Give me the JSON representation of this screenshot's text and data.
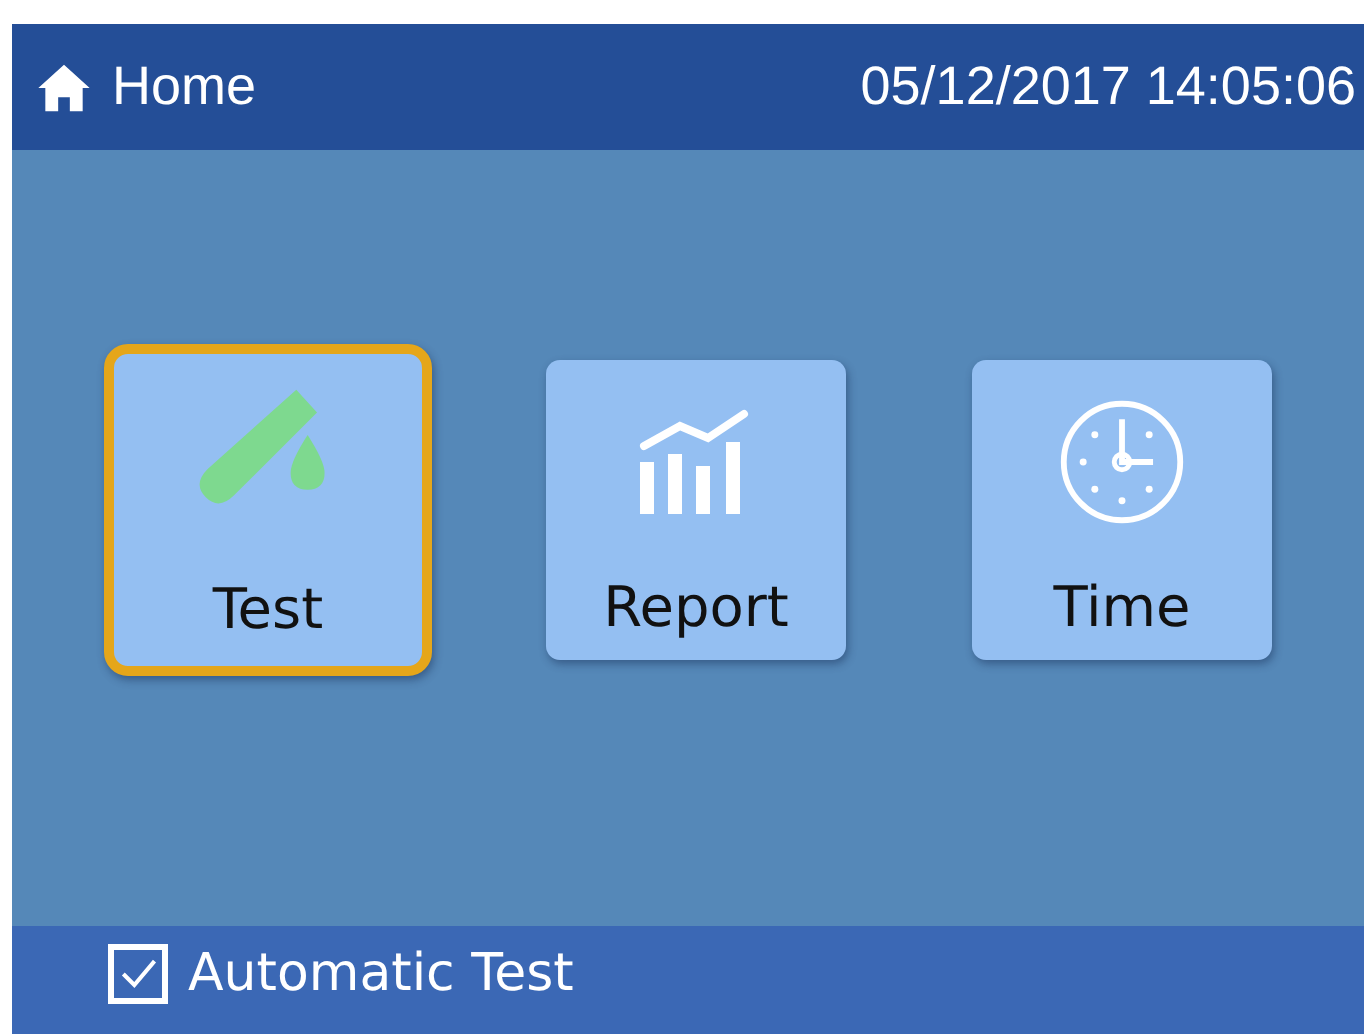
{
  "header": {
    "title": "Home",
    "datetime": "05/12/2017 14:05:06"
  },
  "tiles": [
    {
      "label": "Test",
      "kind": "test",
      "selected": true
    },
    {
      "label": "Report",
      "kind": "report",
      "selected": false
    },
    {
      "label": "Time",
      "kind": "time",
      "selected": false
    }
  ],
  "footer": {
    "checkbox": {
      "label": "Automatic Test",
      "checked": true
    }
  }
}
